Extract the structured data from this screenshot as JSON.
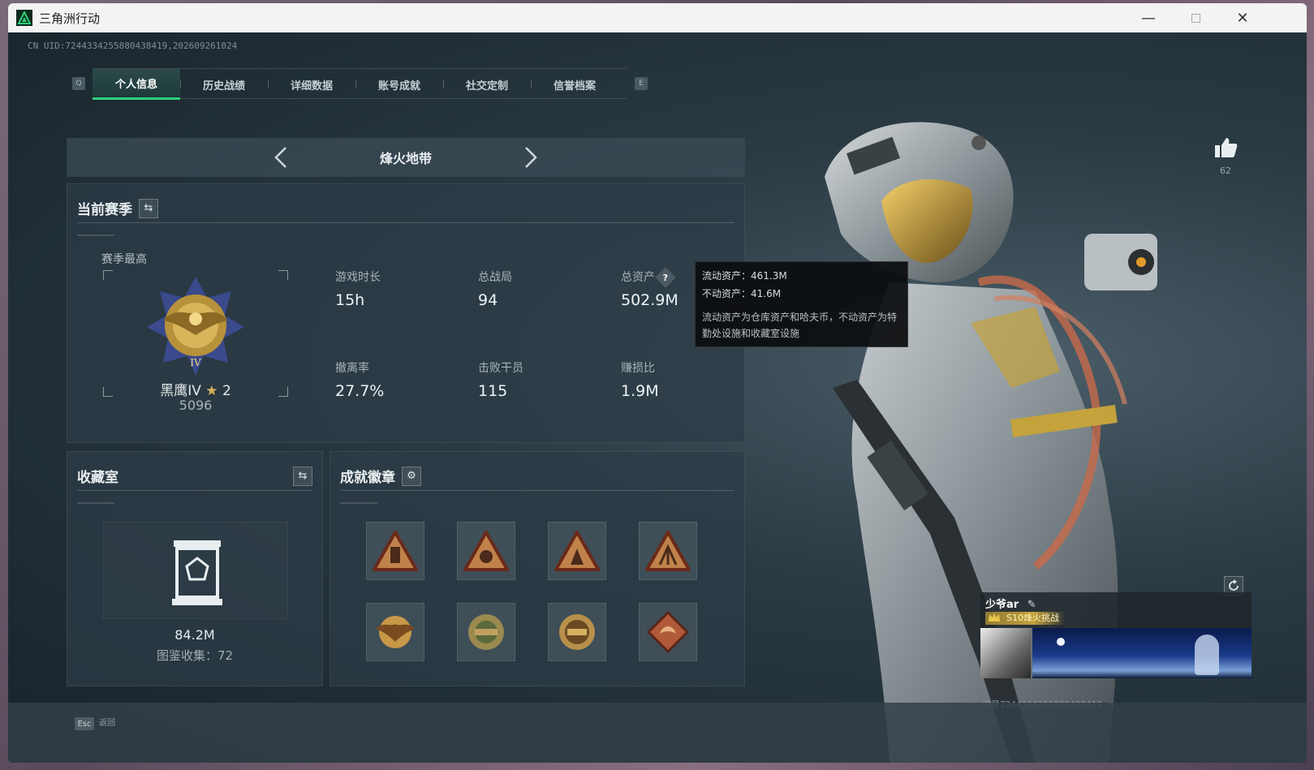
{
  "window": {
    "title": "三角洲行动"
  },
  "uid_line": "CN UID:7244334255880438419,202609261024",
  "tabs": [
    {
      "label": "个人信息",
      "active": true
    },
    {
      "label": "历史战绩",
      "active": false
    },
    {
      "label": "详细数据",
      "active": false
    },
    {
      "label": "账号成就",
      "active": false
    },
    {
      "label": "社交定制",
      "active": false
    },
    {
      "label": "信誉档案",
      "active": false
    }
  ],
  "tab_keys": {
    "left": "Q",
    "right": "E"
  },
  "mode": {
    "title": "烽火地带"
  },
  "season": {
    "title": "当前赛季",
    "best_label": "赛季最高",
    "rank_name": "黑鹰IV",
    "rank_stars": "2",
    "rank_score": "5096",
    "stats": [
      {
        "label": "游戏时长",
        "value": "15h"
      },
      {
        "label": "总战局",
        "value": "94"
      },
      {
        "label": "总资产",
        "value": "502.9M",
        "help": "?"
      },
      {
        "label": "撤离率",
        "value": "27.7%"
      },
      {
        "label": "击败干员",
        "value": "115"
      },
      {
        "label": "赚损比",
        "value": "1.9M"
      }
    ]
  },
  "tooltip": {
    "liquid": "流动资产：461.3M",
    "fixed": "不动资产：41.6M",
    "desc": "流动资产为仓库资产和哈夫币，不动资产为特勤处设施和收藏室设施"
  },
  "collection": {
    "title": "收藏室",
    "value": "84.2M",
    "count": "图鉴收集：72"
  },
  "achievements": {
    "title": "成就徽章",
    "badges": [
      "badge-1",
      "badge-2",
      "badge-3",
      "badge-4",
      "badge-5",
      "badge-6",
      "badge-7",
      "badge-8"
    ]
  },
  "like": {
    "count": "62"
  },
  "player_card": {
    "name": "少爷ar",
    "tag": "S10烽火挑战",
    "id": "编号7244334255880438419"
  },
  "footer": {
    "esc_key": "Esc",
    "esc_label": "返回"
  },
  "colors": {
    "accent": "#2fd07a",
    "panel": "#2c3c46",
    "gold": "#c4a23c"
  }
}
